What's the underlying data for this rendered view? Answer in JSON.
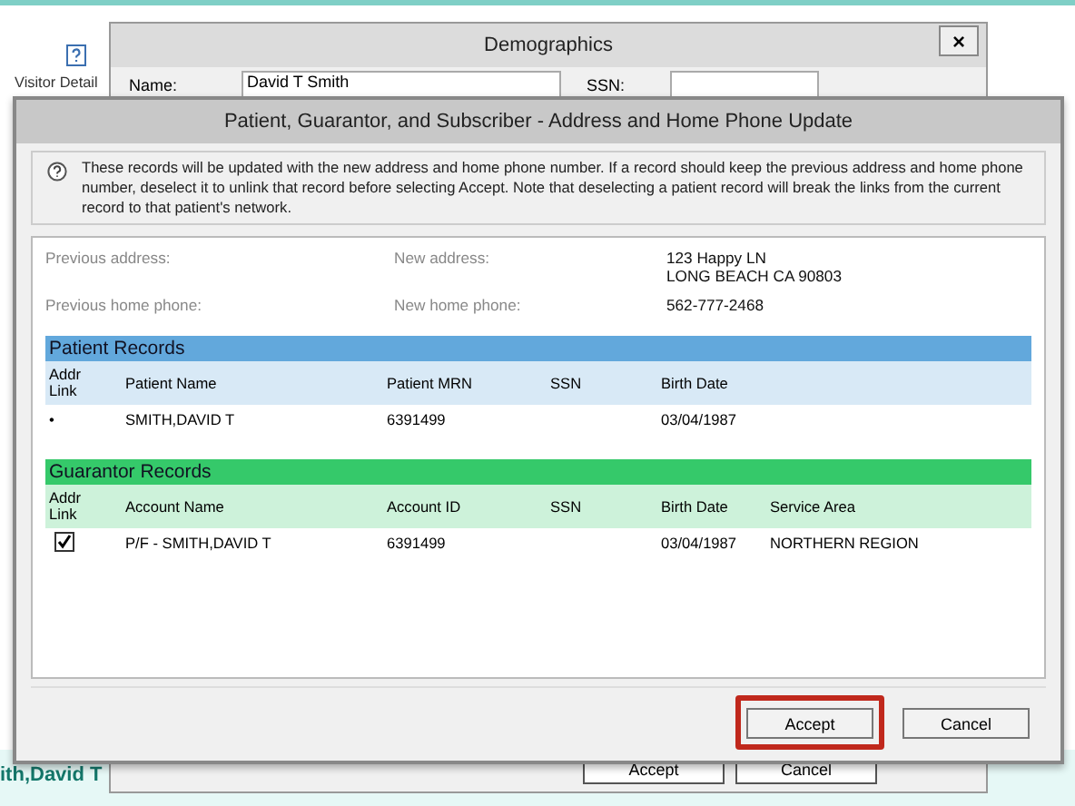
{
  "background_app": {
    "toolbar_item": "Visitor Detail",
    "patient_name": "ith,David T"
  },
  "demographics": {
    "title": "Demographics",
    "close": "×",
    "name_label": "Name:",
    "name_value": "David T Smith",
    "ssn_label": "SSN:",
    "buttons": [
      {
        "label": "Accept"
      },
      {
        "label": "Cancel"
      }
    ]
  },
  "dialog": {
    "title": "Patient, Guarantor, and Subscriber - Address and Home Phone Update",
    "info": "These records will be updated with the new address and home phone number. If a record should keep the previous address and home phone number, deselect it to unlink that record before selecting Accept. Note that deselecting a patient record will break the links from the current record to that patient's network.",
    "previous_address_label": "Previous address:",
    "new_address_label": "New address:",
    "new_address": [
      "123 Happy LN",
      "LONG BEACH CA 90803"
    ],
    "previous_phone_label": "Previous home phone:",
    "new_phone_label": "New home phone:",
    "new_phone": "562-777-2468",
    "sections": [
      {
        "title": "Patient Records",
        "color": "#62a8dc",
        "link_column": "Addr\nLink",
        "columns": [
          "Patient Name",
          "Patient MRN",
          "SSN",
          "Birth Date"
        ],
        "rows": [
          {
            "link": {
              "kind": "bullet",
              "text": "•"
            },
            "cells": [
              "SMITH,DAVID T",
              "6391499",
              "",
              "03/04/1987"
            ]
          }
        ]
      },
      {
        "title": "Guarantor Records",
        "color": "#35c96a",
        "link_column": "Addr\nLink",
        "columns": [
          "Account Name",
          "Account ID",
          "SSN",
          "Birth Date",
          "Service Area"
        ],
        "rows": [
          {
            "link": {
              "kind": "checkbox",
              "checked": true
            },
            "cells": [
              "P/F - SMITH,DAVID T",
              "6391499",
              "",
              "03/04/1987",
              "NORTHERN REGION"
            ]
          }
        ]
      }
    ],
    "buttons": [
      {
        "label": "Accept",
        "highlighted": true
      },
      {
        "label": "Cancel",
        "highlighted": false
      }
    ]
  }
}
